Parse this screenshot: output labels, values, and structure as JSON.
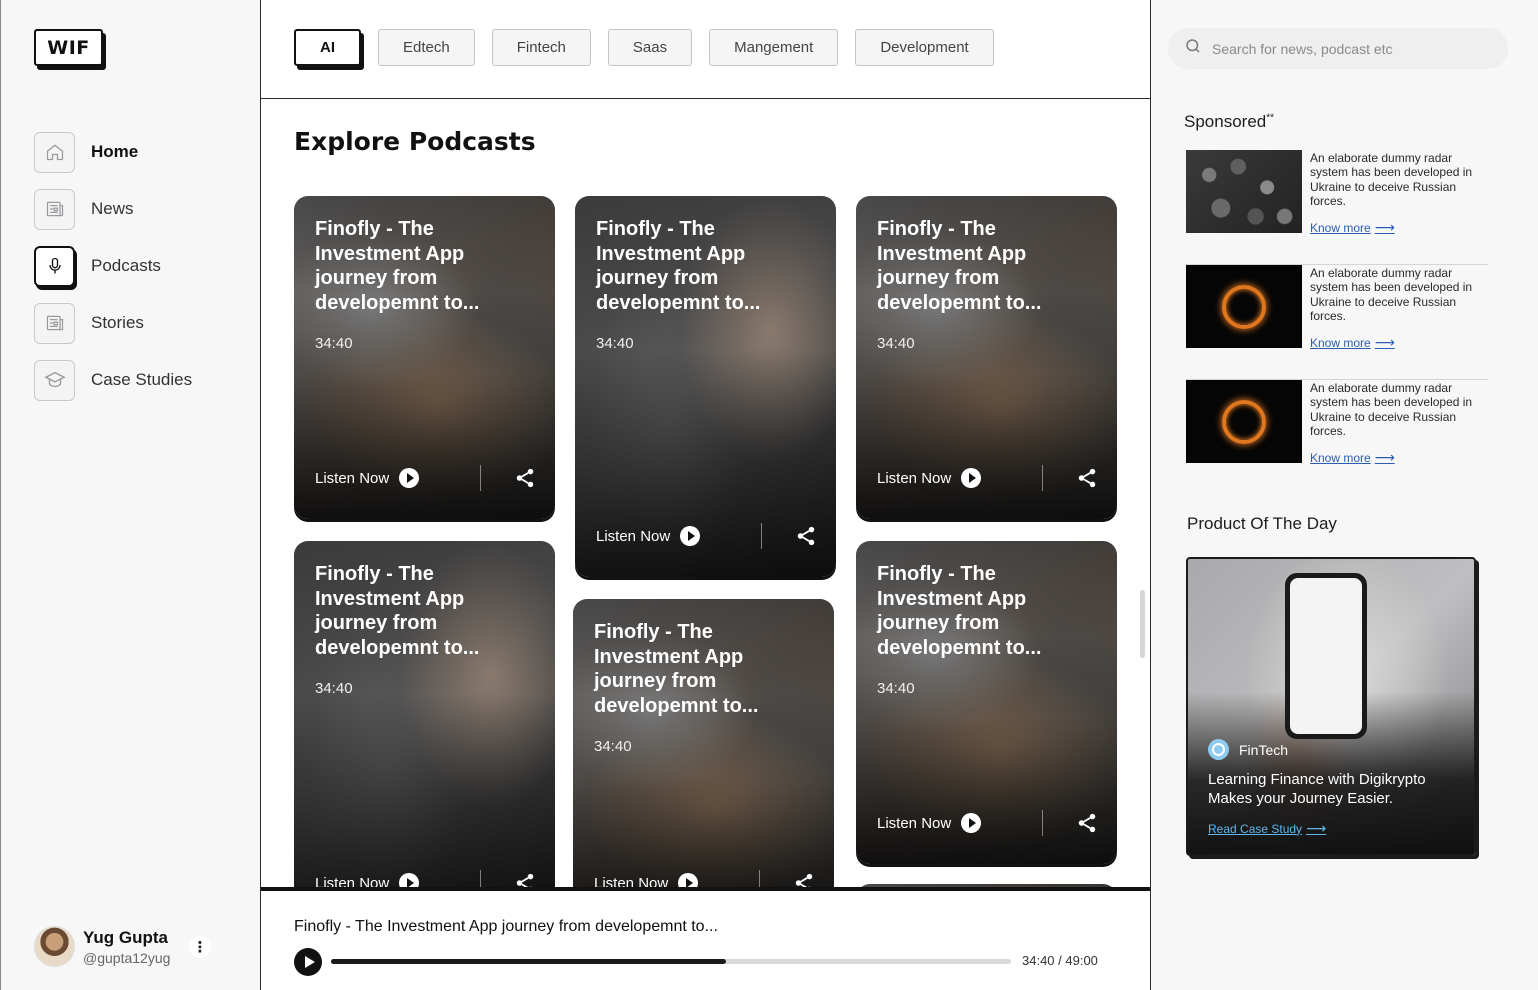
{
  "logo": "WIF",
  "nav": [
    {
      "label": "Home",
      "icon": "home-icon"
    },
    {
      "label": "News",
      "icon": "news-icon"
    },
    {
      "label": "Podcasts",
      "icon": "microphone-icon"
    },
    {
      "label": "Stories",
      "icon": "stories-icon"
    },
    {
      "label": "Case Studies",
      "icon": "graduation-cap-icon"
    }
  ],
  "user": {
    "name": "Yug Gupta",
    "handle": "@gupta12yug",
    "more": "⋮"
  },
  "categories": [
    "AI",
    "Edtech",
    "Fintech",
    "Saas",
    "Mangement",
    "Development"
  ],
  "section_title": "Explore Podcasts",
  "cards": [
    {
      "title": "Finofly - The Investment App journey from developemnt to...",
      "duration": "34:40",
      "cta": "Listen Now"
    },
    {
      "title": "Finofly - The Investment App journey from developemnt to...",
      "duration": "34:40",
      "cta": "Listen Now"
    },
    {
      "title": "Finofly - The Investment App journey from developemnt to...",
      "duration": "34:40",
      "cta": "Listen Now"
    },
    {
      "title": "Finofly - The Investment App journey from developemnt to...",
      "duration": "34:40",
      "cta": "Listen Now"
    },
    {
      "title": "Finofly - The Investment App journey from developemnt to...",
      "duration": "34:40",
      "cta": "Listen Now"
    },
    {
      "title": "Finofly - The Investment App journey from developemnt to...",
      "duration": "34:40",
      "cta": "Listen Now"
    }
  ],
  "player": {
    "title": "Finofly - The Investment App journey from developemnt to...",
    "time": "34:40 / 49:00",
    "progress": 0.5804
  },
  "search": {
    "placeholder": "Search for news, podcast etc"
  },
  "sponsored": {
    "title": "Sponsored",
    "mark": "**",
    "ads": [
      {
        "text": "An elaborate dummy radar system has been developed in Ukraine to deceive Russian forces.",
        "link": "Know more"
      },
      {
        "text": "An elaborate dummy radar system has been developed in Ukraine to deceive Russian forces.",
        "link": "Know more"
      },
      {
        "text": "An elaborate dummy radar system has been developed in Ukraine to deceive Russian forces.",
        "link": "Know more"
      }
    ]
  },
  "product_of_day": {
    "title": "Product Of The Day",
    "tag": "FinTech",
    "text": "Learning Finance with Digikrypto Makes your Journey Easier.",
    "link": "Read Case Study"
  },
  "colors": {
    "accent": "#111111",
    "link": "#2b5fae",
    "link_light": "#62b6ea",
    "sidebar_bg": "#f7f7f8"
  }
}
